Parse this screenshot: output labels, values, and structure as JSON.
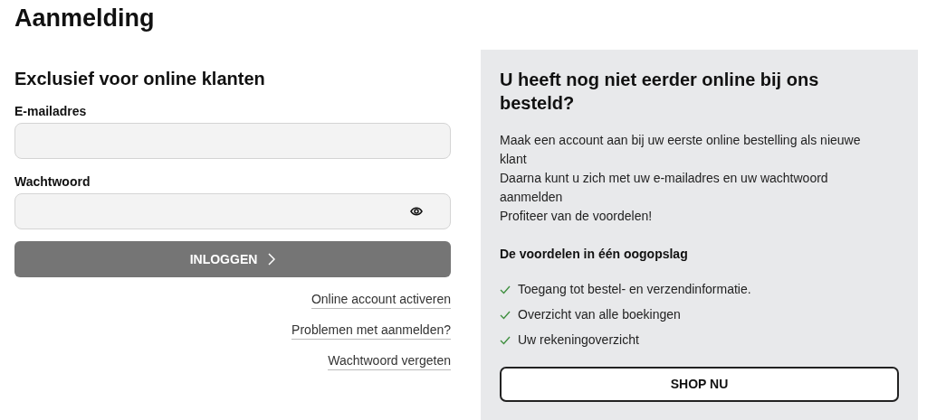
{
  "page_title": "Aanmelding",
  "login": {
    "heading": "Exclusief voor online klanten",
    "fields": [
      {
        "label": "E-mailadres",
        "kind": "text"
      },
      {
        "label": "Wachtwoord",
        "kind": "password"
      }
    ],
    "submit": "INLOGGEN",
    "links": [
      "Online account activeren",
      "Problemen met aanmelden?",
      "Wachtwoord vergeten"
    ]
  },
  "signup_panel": {
    "heading": "U heeft nog niet eerder online bij ons besteld?",
    "lines": [
      "Maak een account aan bij uw eerste online bestelling als nieuwe klant",
      "Daarna kunt u zich met uw e-mailadres en uw wachtwoord aanmelden",
      "Profiteer van de voordelen!"
    ],
    "benefits_heading": "De voordelen in één oogopslag",
    "benefits": [
      "Toegang tot bestel- en verzendinformatie.",
      "Overzicht van alle boekingen",
      "Uw rekeningoverzicht"
    ],
    "button": "SHOP NU"
  }
}
